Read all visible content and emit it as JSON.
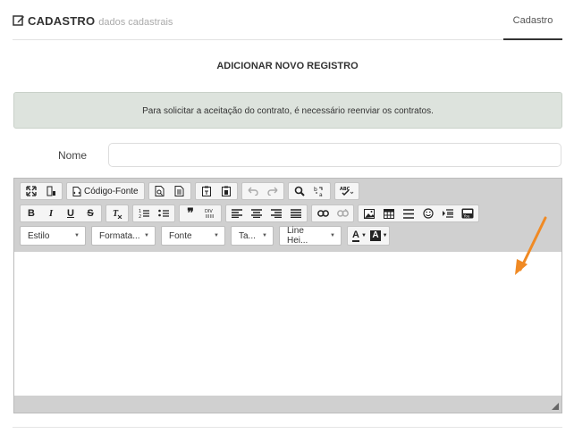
{
  "header": {
    "title": "CADASTRO",
    "subtitle": "dados cadastrais",
    "tab_label": "Cadastro"
  },
  "form": {
    "title": "ADICIONAR NOVO REGISTRO",
    "alert_text": "Para solicitar a aceitação do contrato, é necessário reenviar os contratos.",
    "name_label": "Nome",
    "name_value": ""
  },
  "editor": {
    "source_label": "Código-Fonte",
    "combos": {
      "style": "Estilo",
      "format": "Formata...",
      "font": "Fonte",
      "size": "Ta...",
      "line_height": "Line Hei..."
    },
    "text_color_label": "A",
    "bg_color_label": "A",
    "content": ""
  },
  "colors": {
    "accent_arrow": "#f08a24",
    "alert_bg": "#dde3dd",
    "toolbar_bg": "#d0d0d0"
  }
}
